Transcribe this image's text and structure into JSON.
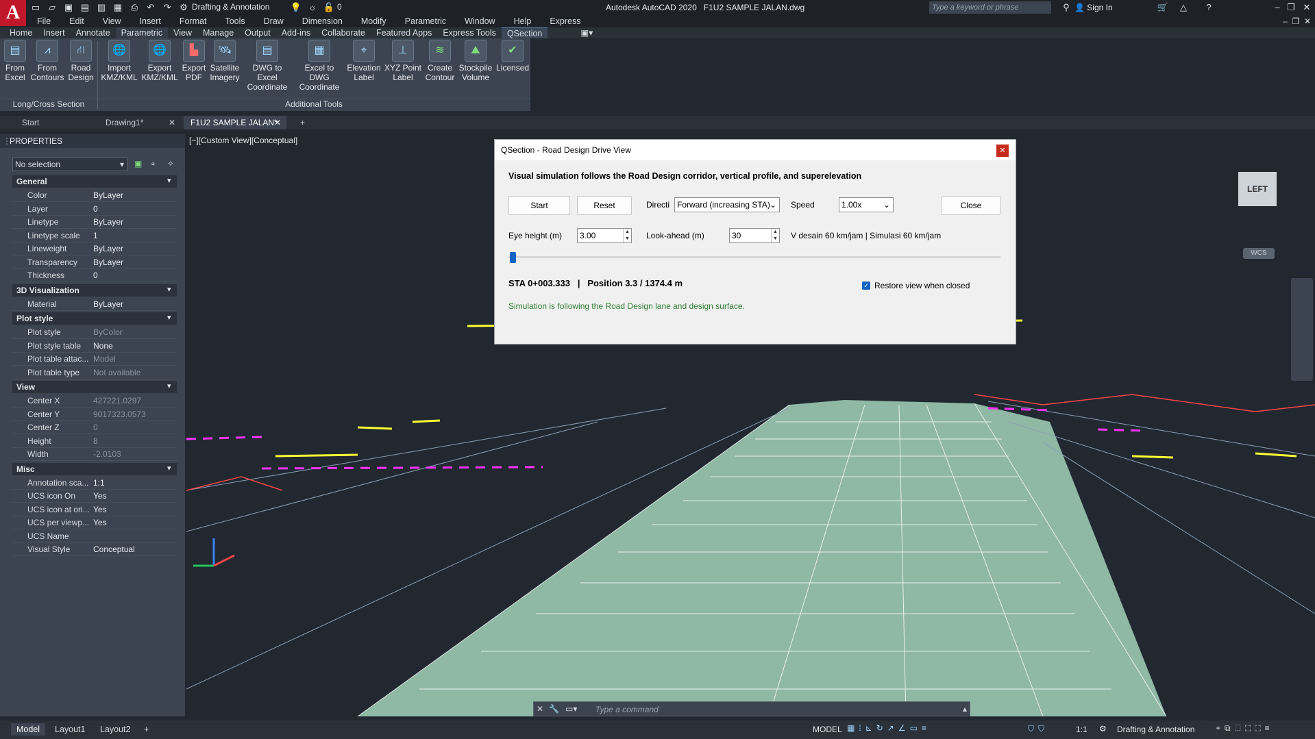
{
  "app": {
    "title": "Autodesk AutoCAD 2020",
    "document": "F1U2 SAMPLE JALAN.dwg",
    "workspace": "Drafting & Annotation",
    "layer_current": "0",
    "search_placeholder": "Type a keyword or phrase",
    "sign_in": "Sign In"
  },
  "menubar": [
    "File",
    "Edit",
    "View",
    "Insert",
    "Format",
    "Tools",
    "Draw",
    "Dimension",
    "Modify",
    "Parametric",
    "Window",
    "Help",
    "Express"
  ],
  "ribbon_tabs": [
    "Home",
    "Insert",
    "Annotate",
    "Parametric",
    "View",
    "Manage",
    "Output",
    "Add-ins",
    "Collaborate",
    "Featured Apps",
    "Express Tools",
    "QSection"
  ],
  "ribbon_active_tab": "QSection",
  "ribbon_buttons": [
    {
      "label": "From Excel"
    },
    {
      "label": "From Contours"
    },
    {
      "label": "Road Design"
    },
    {
      "label": "Import KMZ/KML"
    },
    {
      "label": "Export KMZ/KML"
    },
    {
      "label": "Export PDF"
    },
    {
      "label": "Satellite Imagery"
    },
    {
      "label": "DWG to Excel Coordinate"
    },
    {
      "label": "Excel to DWG Coordinate"
    },
    {
      "label": "Elevation Label"
    },
    {
      "label": "XYZ Point Label"
    },
    {
      "label": "Create Contour"
    },
    {
      "label": "Stockpile Volume"
    },
    {
      "label": "Licensed"
    }
  ],
  "ribbon_panels": [
    "Long/Cross Section",
    "Additional Tools"
  ],
  "file_tabs": [
    "Start",
    "Drawing1*",
    "F1U2 SAMPLE JALAN*"
  ],
  "properties": {
    "title": "PROPERTIES",
    "selection": "No selection",
    "sections": [
      {
        "name": "General",
        "rows": [
          [
            "Color",
            "ByLayer"
          ],
          [
            "Layer",
            "0"
          ],
          [
            "Linetype",
            "ByLayer"
          ],
          [
            "Linetype scale",
            "1"
          ],
          [
            "Lineweight",
            "ByLayer"
          ],
          [
            "Transparency",
            "ByLayer"
          ],
          [
            "Thickness",
            "0"
          ]
        ]
      },
      {
        "name": "3D Visualization",
        "rows": [
          [
            "Material",
            "ByLayer"
          ]
        ]
      },
      {
        "name": "Plot style",
        "rows": [
          [
            "Plot style",
            "ByColor"
          ],
          [
            "Plot style table",
            "None"
          ],
          [
            "Plot table attac...",
            "Model"
          ],
          [
            "Plot table type",
            "Not available"
          ]
        ]
      },
      {
        "name": "View",
        "rows": [
          [
            "Center X",
            "427221.0297"
          ],
          [
            "Center Y",
            "9017323.0573"
          ],
          [
            "Center Z",
            "0"
          ],
          [
            "Height",
            "8"
          ],
          [
            "Width",
            "-2.0103"
          ]
        ]
      },
      {
        "name": "Misc",
        "rows": [
          [
            "Annotation sca...",
            "1:1"
          ],
          [
            "UCS icon On",
            "Yes"
          ],
          [
            "UCS icon at ori...",
            "Yes"
          ],
          [
            "UCS per viewp...",
            "Yes"
          ],
          [
            "UCS Name",
            ""
          ],
          [
            "Visual Style",
            "Conceptual"
          ]
        ]
      }
    ]
  },
  "viewport": {
    "label": "[−][Custom View][Conceptual]",
    "viewcube": "LEFT",
    "wcs": "WCS"
  },
  "dialog": {
    "title": "QSection - Road Design Drive View",
    "heading": "Visual simulation follows the Road Design corridor, vertical profile, and superelevation",
    "start": "Start",
    "reset": "Reset",
    "direction_label": "Directi",
    "direction_value": "Forward (increasing STA)",
    "speed_label": "Speed",
    "speed_value": "1.00x",
    "close": "Close",
    "eye_label": "Eye height (m)",
    "eye_value": "3.00",
    "lookahead_label": "Look-ahead (m)",
    "lookahead_value": "30",
    "speed_info": "V desain 60 km/jam  |  Simulasi 60 km/jam",
    "progress_fraction": 0.0024,
    "sta": "STA 0+003.333",
    "sep": "|",
    "position": "Position 3.3 / 1374.4 m",
    "restore_label": "Restore view when closed",
    "status": "Simulation is following the Road Design lane and design surface."
  },
  "command": {
    "placeholder": "Type a command"
  },
  "layout_tabs": [
    "Model",
    "Layout1",
    "Layout2"
  ],
  "status": {
    "model": "MODEL",
    "scale": "1:1",
    "workspace": "Drafting & Annotation"
  },
  "colors": {
    "accent": "#3b82c4",
    "status_green": "#2e7d32",
    "road_surface": "#8fb8a5"
  }
}
